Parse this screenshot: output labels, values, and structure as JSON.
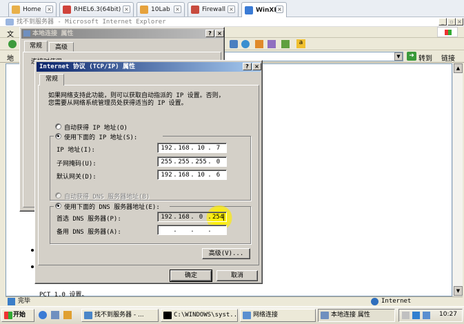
{
  "vm_tabs": [
    {
      "label": "Home",
      "color": "#e8b04a"
    },
    {
      "label": "RHEL6.3(64bit)",
      "color": "#d0433b"
    },
    {
      "label": "10Lab",
      "color": "#e6a23c"
    },
    {
      "label": "Firewall",
      "color": "#c84b3e"
    },
    {
      "label": "WinXP",
      "color": "#3a7bd5"
    }
  ],
  "ie": {
    "title": "找不到服务器 - Microsoft Internet Explorer",
    "menu_first": "文",
    "addr_label": "地",
    "go_label": "转到",
    "links_label": "链接",
    "status": "完毕",
    "zone": "Internet",
    "bottom_text": "PCT 1.0 设置。"
  },
  "local_conn": {
    "title": "本地连接 属性",
    "tab_general": "常规",
    "tab_advanced": "高级",
    "partial": "连接时使用"
  },
  "tcpip": {
    "title": "Internet 协议 (TCP/IP) 属性",
    "tab": "常规",
    "desc_line1": "如果网络支持此功能，则可以获取自动指派的 IP 设置。否则，",
    "desc_line2": "您需要从网络系统管理员处获得适当的 IP 设置。",
    "auto_ip": "自动获得 IP 地址(O)",
    "manual_ip": "使用下面的 IP 地址(S):",
    "ip_label": "IP 地址(I):",
    "mask_label": "子网掩码(U):",
    "gw_label": "默认网关(D):",
    "ip": [
      "192",
      "168",
      "10",
      "7"
    ],
    "mask": [
      "255",
      "255",
      "255",
      "0"
    ],
    "gw": [
      "192",
      "168",
      "10",
      "6"
    ],
    "auto_dns": "自动获得 DNS 服务器地址(B)",
    "manual_dns": "使用下面的 DNS 服务器地址(E):",
    "dns1_label": "首选 DNS 服务器(P):",
    "dns2_label": "备用 DNS 服务器(A):",
    "dns1": [
      "192",
      "168",
      "0",
      "254"
    ],
    "dns2": [
      "",
      "",
      "",
      ""
    ],
    "advanced_btn": "高级(V)...",
    "ok_btn": "确定",
    "cancel_btn": "取消"
  },
  "taskbar": {
    "start": "开始",
    "items": [
      "找不到服务器 - ...",
      "C:\\WINDOWS\\syst...",
      "网络连接",
      "本地连接 属性"
    ],
    "time": "10:27"
  }
}
